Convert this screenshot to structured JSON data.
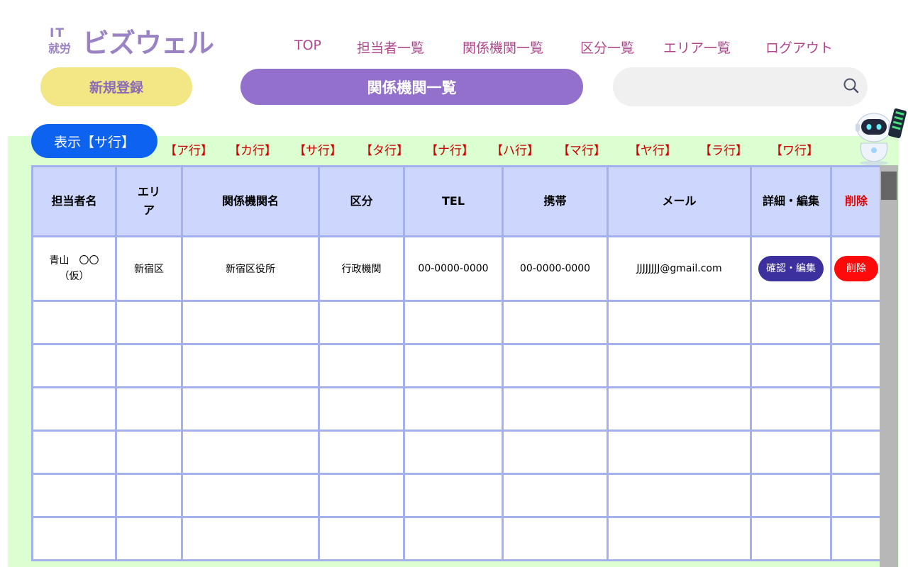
{
  "logo": {
    "it": "IT",
    "shuro": "就労",
    "main": "ビズウェル"
  },
  "nav": {
    "items": [
      {
        "label": "TOP"
      },
      {
        "label": "担当者一覧"
      },
      {
        "label": "関係機関一覧"
      },
      {
        "label": "区分一覧"
      },
      {
        "label": "エリア一覧"
      },
      {
        "label": "ログアウト"
      }
    ]
  },
  "actions": {
    "new_label": "新規登録"
  },
  "page_title": "関係機関一覧",
  "search": {
    "value": "",
    "placeholder": "",
    "icon": "search-icon"
  },
  "filter": {
    "display_label": "表示【サ行】",
    "kana": [
      "【ア行】",
      "【カ行】",
      "【サ行】",
      "【タ行】",
      "【ナ行】",
      "【ハ行】",
      "【マ行】",
      "【ヤ行】",
      "【ラ行】",
      "【ワ行】"
    ]
  },
  "table": {
    "headers": [
      "担当者名",
      "エリア",
      "関係機関名",
      "区分",
      "TEL",
      "携帯",
      "メール",
      "詳細・編集",
      "削除"
    ],
    "rows": [
      {
        "person": "青山　〇〇（仮）",
        "area": "新宿区",
        "org": "新宿区役所",
        "category": "行政機関",
        "tel": "00-0000-0000",
        "mobile": "00-0000-0000",
        "email": "JJJJJJJJ@gmail.com",
        "edit_label": "確認・編集",
        "delete_label": "削除"
      }
    ],
    "empty_rows": 6
  },
  "colors": {
    "accent_purple": "#9370cc",
    "nav_text": "#b0478e",
    "new_button": "#f2e784",
    "display_pill": "#0d62f0",
    "kana_text": "#cc0000",
    "panel_bg": "#dbffd0",
    "header_bg": "#cdd6fc",
    "grid": "#a4b1ec",
    "edit_button": "#3c2f9e",
    "delete_button": "#ff0a0a"
  }
}
